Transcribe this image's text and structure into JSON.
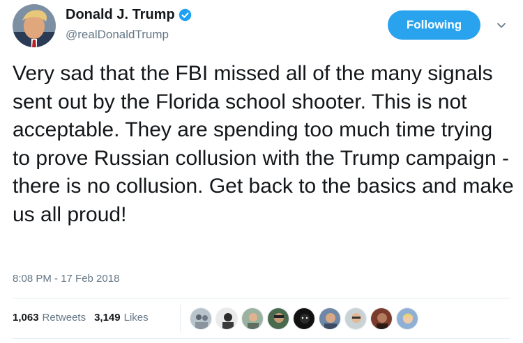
{
  "user": {
    "display_name": "Donald J. Trump",
    "handle": "@realDonaldTrump",
    "verified": true,
    "avatar_icon": "profile-photo"
  },
  "follow_button": {
    "label": "Following",
    "color": "#2aa3ef"
  },
  "menu": {
    "icon": "chevron-down-icon"
  },
  "tweet": {
    "text": "Very sad that the FBI missed all of the many signals sent out by the Florida school shooter. This is not acceptable. They are spending too much time trying to prove Russian collusion with the Trump campaign - there is no collusion. Get back to the basics and make us all proud!",
    "timestamp": "8:08 PM - 17 Feb 2018"
  },
  "stats": {
    "retweets": {
      "count": "1,063",
      "label": "Retweets"
    },
    "likes": {
      "count": "3,149",
      "label": "Likes"
    }
  },
  "likers": [
    {
      "icon": "avatar-1"
    },
    {
      "icon": "avatar-2"
    },
    {
      "icon": "avatar-3"
    },
    {
      "icon": "avatar-4"
    },
    {
      "icon": "avatar-5"
    },
    {
      "icon": "avatar-6"
    },
    {
      "icon": "avatar-7"
    },
    {
      "icon": "avatar-8"
    },
    {
      "icon": "avatar-9"
    }
  ],
  "colors": {
    "text": "#14171a",
    "muted": "#657786",
    "accent": "#2aa3ef",
    "divider": "#e6ecf0"
  }
}
